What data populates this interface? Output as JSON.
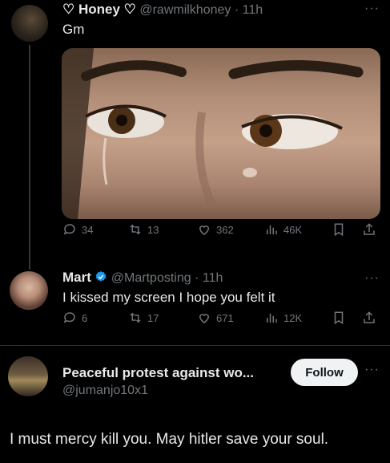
{
  "tweet1": {
    "display_name": "♡ Honey ♡",
    "handle_time": "@rawmilkhoney · 11h",
    "text": "Gm",
    "more": "···",
    "stats": {
      "replies": "34",
      "retweets": "13",
      "likes": "362",
      "views": "46K"
    }
  },
  "tweet2": {
    "display_name": "Mart",
    "handle_time": "@Martposting · 11h",
    "text": "I kissed my screen I hope you felt it",
    "more": "···",
    "stats": {
      "replies": "6",
      "retweets": "17",
      "likes": "671",
      "views": "12K"
    }
  },
  "tweet3": {
    "display_name": "Peaceful protest against wo...",
    "handle": "@jumanjo10x1",
    "follow_label": "Follow",
    "more": "···",
    "text": "I must mercy kill you. May hitler save your soul."
  },
  "colors": {
    "background": "#000000",
    "text": "#e7e9ea",
    "muted": "#71767b",
    "verified": "#1d9bf0"
  }
}
